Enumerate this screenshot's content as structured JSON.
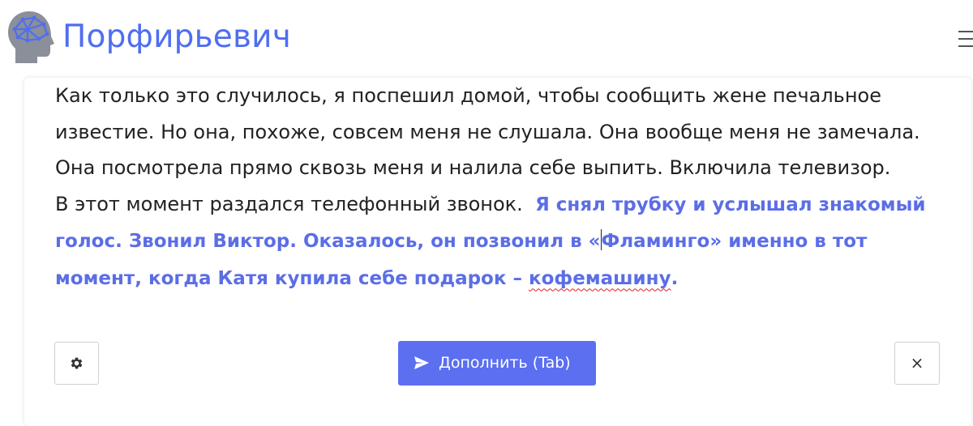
{
  "header": {
    "brand": "Порфирьевич",
    "logo_icon": "brain-head-icon",
    "menu_icon": "hamburger-menu-icon"
  },
  "editor": {
    "user_text_lines": [
      "Как только это случилось, я поспешил домой, чтобы сообщить жене печальное известие. Но она, похоже, совсем меня не слушала. Она вообще меня не замечала. Она посмотрела прямо сквозь меня и налила себе выпить. Включила телевизор.",
      "В этот момент раздался телефонный звонок. "
    ],
    "generated_part1": "Я снял трубку и услышал знакомый голос. Звонил Виктор. Оказалось, он позвонил в «",
    "generated_part2": "Фламинго» именно в тот момент, когда Катя купила себе подарок – ",
    "generated_misspelled": "кофемашину",
    "generated_end": "."
  },
  "buttons": {
    "settings_icon": "gear-icon",
    "complete_label": "Дополнить (Tab)",
    "complete_icon": "send-icon",
    "close_label": "×"
  },
  "colors": {
    "brand": "#4f6ef0",
    "generated_text": "#5b6ee6",
    "primary_button": "#5b6ff0"
  }
}
